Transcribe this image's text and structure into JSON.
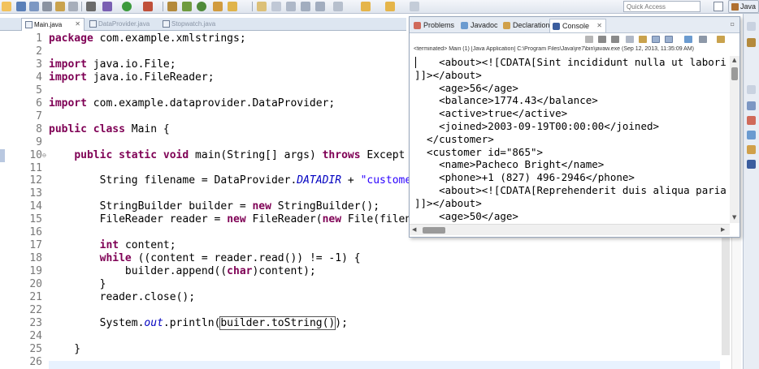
{
  "toolbar": {
    "quick_access_placeholder": "Quick Access",
    "perspective_label": "Java"
  },
  "editor_tabs": [
    {
      "label": "Main.java",
      "active": true
    },
    {
      "label": "DataProvider.java",
      "active": false
    },
    {
      "label": "Stopwatch.java",
      "active": false
    }
  ],
  "editor": {
    "lines": [
      {
        "n": "1",
        "code": "package com.example.xmlstrings;"
      },
      {
        "n": "2",
        "code": ""
      },
      {
        "n": "3",
        "code": "import java.io.File;"
      },
      {
        "n": "4",
        "code": "import java.io.FileReader;"
      },
      {
        "n": "5",
        "code": ""
      },
      {
        "n": "6",
        "code": "import com.example.dataprovider.DataProvider;"
      },
      {
        "n": "7",
        "code": ""
      },
      {
        "n": "8",
        "code": "public class Main {"
      },
      {
        "n": "9",
        "code": ""
      },
      {
        "n": "10",
        "code": "    public static void main(String[] args) throws Except"
      },
      {
        "n": "11",
        "code": ""
      },
      {
        "n": "12",
        "code": "        String filename = DataProvider.DATADIR + \"customer"
      },
      {
        "n": "13",
        "code": ""
      },
      {
        "n": "14",
        "code": "        StringBuilder builder = new StringBuilder();"
      },
      {
        "n": "15",
        "code": "        FileReader reader = new FileReader(new File(filen"
      },
      {
        "n": "16",
        "code": ""
      },
      {
        "n": "17",
        "code": "        int content;"
      },
      {
        "n": "18",
        "code": "        while ((content = reader.read()) != -1) {"
      },
      {
        "n": "19",
        "code": "            builder.append((char)content);"
      },
      {
        "n": "20",
        "code": "        }"
      },
      {
        "n": "21",
        "code": "        reader.close();"
      },
      {
        "n": "22",
        "code": ""
      },
      {
        "n": "23",
        "code": "        System.out.println(builder.toString());"
      },
      {
        "n": "24",
        "code": ""
      },
      {
        "n": "25",
        "code": "    }"
      },
      {
        "n": "26",
        "code": ""
      }
    ]
  },
  "console_panel": {
    "tabs": [
      {
        "label": "Problems",
        "active": false
      },
      {
        "label": "Javadoc",
        "active": false
      },
      {
        "label": "Declaration",
        "active": false
      },
      {
        "label": "Console",
        "active": true
      }
    ],
    "status": "<terminated> Main (1) [Java Application] C:\\Program Files\\Java\\jre7\\bin\\javaw.exe (Sep 12, 2013, 11:35:09 AM)",
    "output_lines": [
      "    <about><![CDATA[Sint incididunt nulla ut labori",
      "]]></about>",
      "    <age>56</age>",
      "    <balance>1774.43</balance>",
      "    <active>true</active>",
      "    <joined>2003-09-19T00:00:00</joined>",
      "  </customer>",
      "  <customer id=\"865\">",
      "    <name>Pacheco Bright</name>",
      "    <phone>+1 (827) 496-2946</phone>",
      "    <about><![CDATA[Reprehenderit duis aliqua paria",
      "]]></about>",
      "    <age>50</age>"
    ]
  },
  "colors": {
    "keyword": "#7f0055",
    "string": "#2a00ff",
    "static_field": "#0000c0",
    "line_number": "#787878",
    "current_line": "#e8f2fe"
  }
}
